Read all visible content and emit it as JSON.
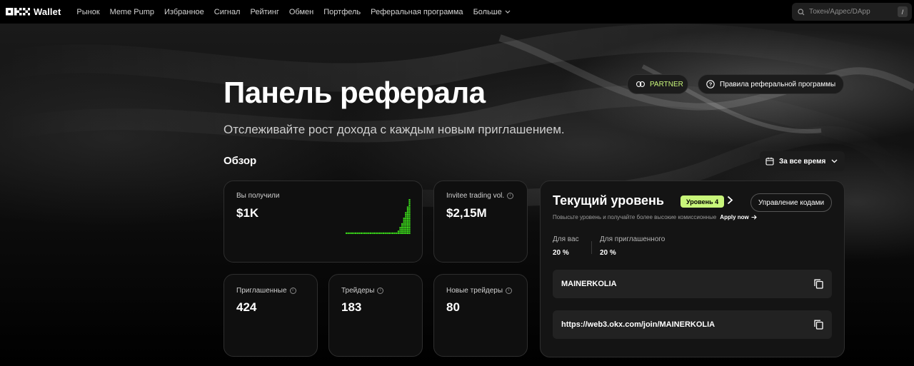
{
  "brand": {
    "logo_text": "Wallet"
  },
  "nav": {
    "items": [
      "Рынок",
      "Meme Pump",
      "Избранное",
      "Сигнал",
      "Рейтинг",
      "Обмен",
      "Портфель",
      "Реферальная программа"
    ],
    "more_label": "Больше"
  },
  "search": {
    "placeholder": "Токен/Адрес/DApp",
    "shortcut": "/"
  },
  "hero": {
    "title": "Панель реферала",
    "subtitle": "Отслеживайте рост дохода с каждым новым приглашением.",
    "partner_label": "PARTNER",
    "rules_label": "Правила реферальной программы"
  },
  "overview": {
    "title": "Обзор",
    "period_label": "За все время",
    "earned": {
      "label": "Вы получили",
      "value": "$1K"
    },
    "volume": {
      "label": "Invitee trading vol.",
      "value": "$2,15M"
    },
    "invited": {
      "label": "Приглашенные",
      "value": "424"
    },
    "traders": {
      "label": "Трейдеры",
      "value": "183"
    },
    "new_traders": {
      "label": "Новые трейдеры",
      "value": "80"
    }
  },
  "level": {
    "title": "Текущий уровень",
    "badge": "Уровень 4",
    "manage_label": "Управление кодами",
    "hint": "Повысьте уровень и получайте более высокие комиссионные",
    "apply_label": "Apply now",
    "you_label": "Для вас",
    "you_value": "20 %",
    "invitee_label": "Для приглашенного",
    "invitee_value": "20 %",
    "code": "MAINERKOLIA",
    "link": "https://web3.okx.com/join/MAINERKOLIA"
  },
  "colors": {
    "accent": "#c8f57a",
    "sparkline": "#39d11a"
  },
  "sparkline_values": [
    0,
    0,
    0,
    0,
    0,
    0,
    0,
    0,
    0,
    0,
    0,
    0,
    0,
    0,
    0,
    0,
    0,
    0,
    0,
    0,
    0,
    0,
    0,
    0,
    0,
    0,
    0,
    0.05,
    0.1,
    0.2,
    0.3,
    0.45,
    0.6,
    0.8,
    1.0
  ]
}
